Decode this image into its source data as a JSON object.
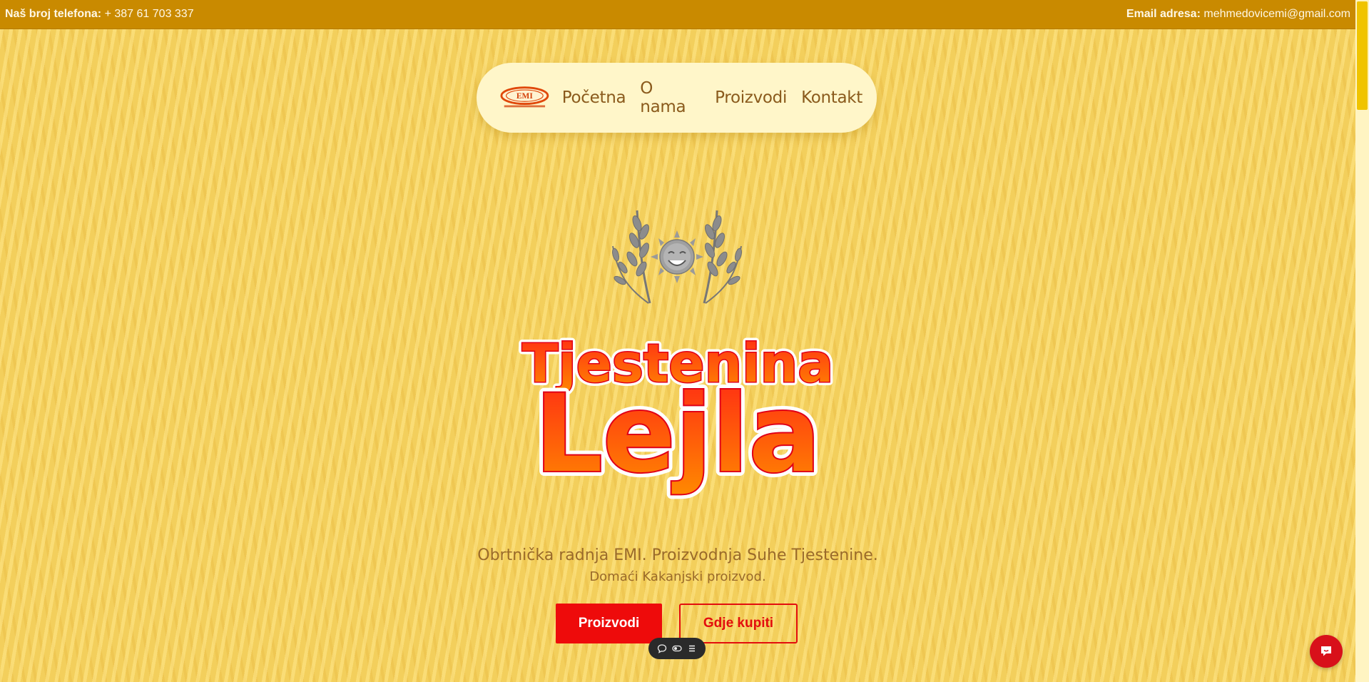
{
  "topbar": {
    "phone_label": "Naš broj telefona:",
    "phone_value": "+ 387 61 703 337",
    "email_label": "Email adresa:",
    "email_value": "mehmedovicemi@gmail.com"
  },
  "nav": {
    "logo_text": "EMI",
    "items": [
      {
        "label": "Početna"
      },
      {
        "label": "O nama"
      },
      {
        "label": "Proizvodi"
      },
      {
        "label": "Kontakt"
      }
    ]
  },
  "hero": {
    "brand_line1": "Tjestenina",
    "brand_line2": "Lejla",
    "tagline": "Obrtnička radnja EMI. Proizvodnja Suhe Tjestenine.",
    "subtagline": "Domaći Kakanjski proizvod.",
    "primary_button": "Proizvodi",
    "secondary_button": "Gdje kupiti"
  },
  "toolbar": {
    "icons": [
      "comment-icon",
      "toggle-icon",
      "list-icon"
    ]
  },
  "colors": {
    "topbar": "#c98a00",
    "background": "#f3cf5c",
    "nav_pill": "#fff6c9",
    "accent_red": "#ee0b0b",
    "brand_orange": "#ff5a0a",
    "text_brown": "#9a6a2a"
  }
}
